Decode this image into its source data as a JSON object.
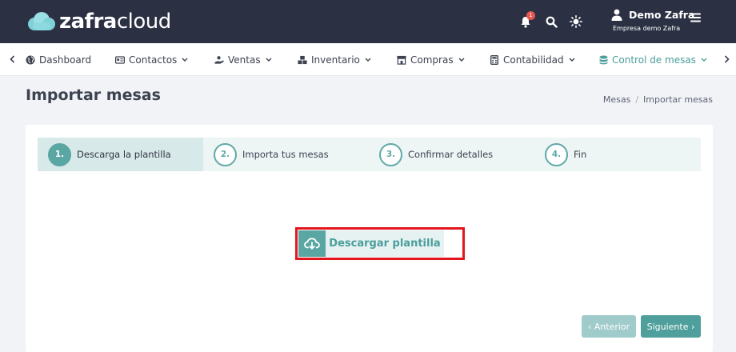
{
  "app": {
    "logo_part1": "zafra",
    "logo_part2": "cloud"
  },
  "header": {
    "notification_count": "1",
    "user_name": "Demo Zafra",
    "user_company": "Empresa demo Zafra",
    "icons": [
      "bell-icon",
      "search-icon",
      "sun-icon",
      "user-icon",
      "hamburger-menu-icon"
    ]
  },
  "nav": {
    "items": [
      {
        "label": "Dashboard",
        "icon": "globe-icon",
        "has_dropdown": false
      },
      {
        "label": "Contactos",
        "icon": "id-card-icon",
        "has_dropdown": true
      },
      {
        "label": "Ventas",
        "icon": "hand-coins-icon",
        "has_dropdown": true
      },
      {
        "label": "Inventario",
        "icon": "boxes-icon",
        "has_dropdown": true
      },
      {
        "label": "Compras",
        "icon": "store-icon",
        "has_dropdown": true
      },
      {
        "label": "Contabilidad",
        "icon": "calculator-icon",
        "has_dropdown": true
      },
      {
        "label": "Control de mesas",
        "icon": "database-icon",
        "has_dropdown": true,
        "active": true
      }
    ],
    "active_color": "#4a9e9b"
  },
  "page": {
    "title": "Importar mesas",
    "breadcrumb": [
      "Mesas",
      "Importar mesas"
    ]
  },
  "wizard": {
    "steps": [
      {
        "num": "1.",
        "label": "Descarga la plantilla",
        "active": true
      },
      {
        "num": "2.",
        "label": "Importa tus mesas",
        "active": false
      },
      {
        "num": "3.",
        "label": "Confirmar detalles",
        "active": false
      },
      {
        "num": "4.",
        "label": "Fin",
        "active": false
      }
    ],
    "download_button": "Descargar plantilla",
    "prev_button": "‹ Anterior",
    "next_button": "Siguiente ›"
  },
  "colors": {
    "header_bg": "#2b3143",
    "accent": "#5aa6a3",
    "highlight": "#e3161e"
  }
}
